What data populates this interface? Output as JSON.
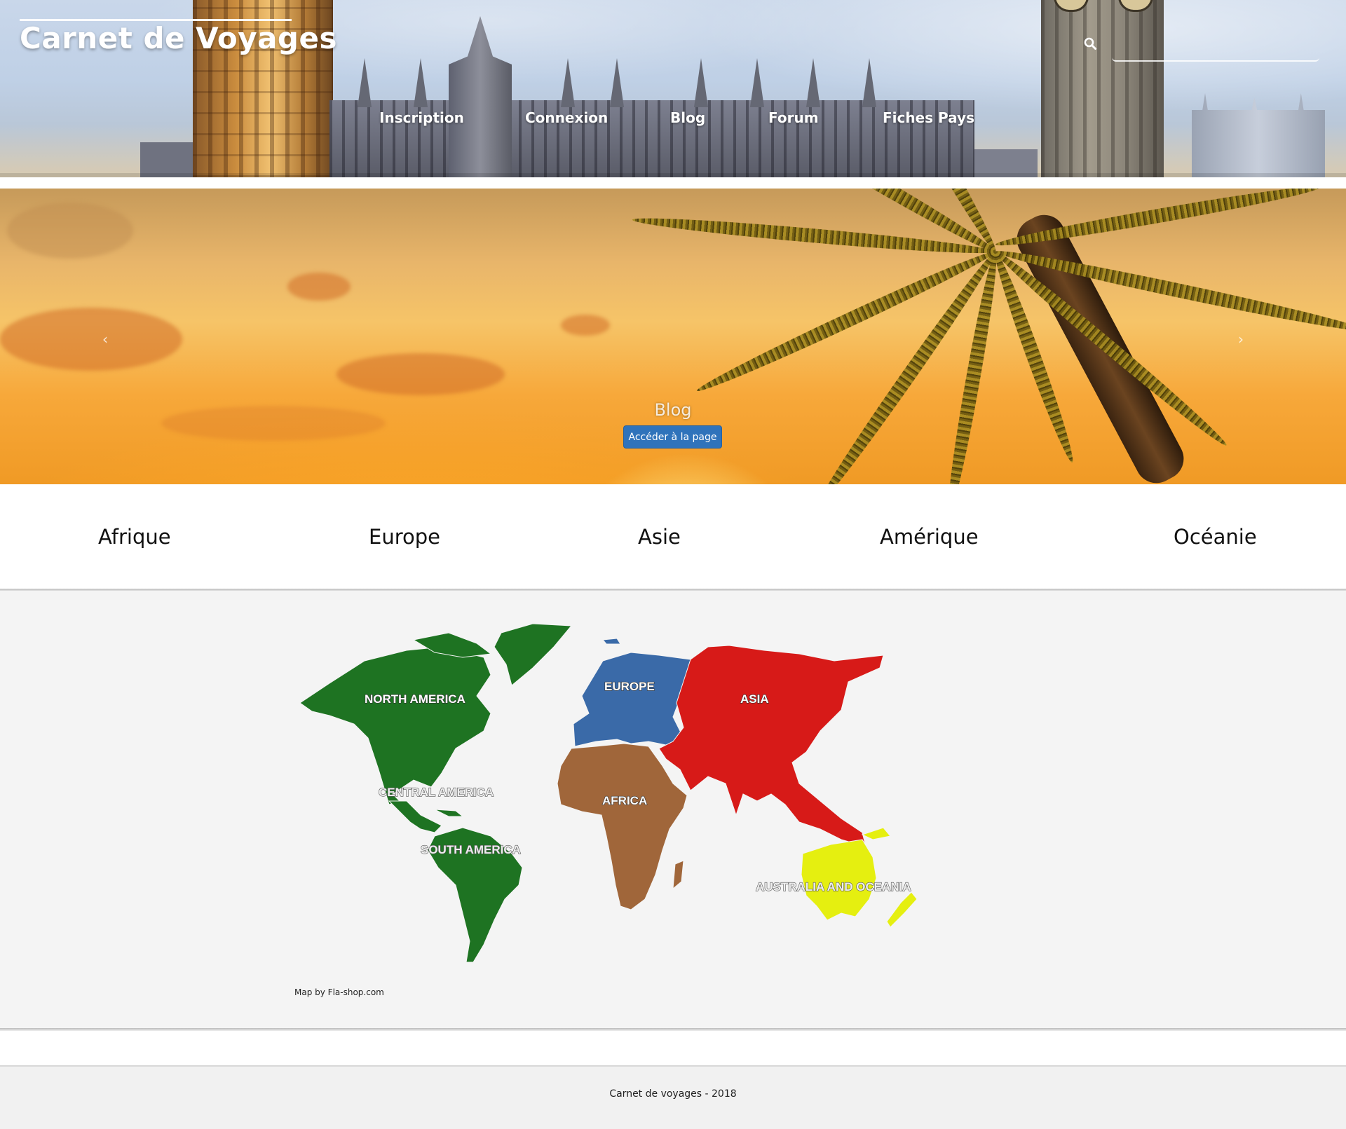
{
  "header": {
    "brand": "Carnet de Voyages",
    "nav": [
      "Inscription",
      "Connexion",
      "Blog",
      "Forum",
      "Fiches Pays"
    ],
    "search": {
      "icon": "search-icon",
      "value": ""
    }
  },
  "carousel": {
    "title": "Blog",
    "button_label": "Accéder à la page",
    "prev_label": "‹",
    "next_label": "›"
  },
  "continents": [
    "Afrique",
    "Europe",
    "Asie",
    "Amérique",
    "Océanie"
  ],
  "map": {
    "labels": {
      "north_america": "NORTH AMERICA",
      "central_america": "CENTRAL AMERICA",
      "south_america": "SOUTH AMERICA",
      "europe": "EUROPE",
      "asia": "ASIA",
      "africa": "AFRICA",
      "oceania": "AUSTRALIA AND OCEANIA"
    },
    "colors": {
      "americas": "#1e7322",
      "europe": "#3a6aa8",
      "asia": "#d71a18",
      "africa": "#a0663a",
      "oceania": "#e5ef10"
    },
    "credit": "Map by Fla-shop.com"
  },
  "footer": {
    "text": "Carnet de voyages - 2018"
  }
}
